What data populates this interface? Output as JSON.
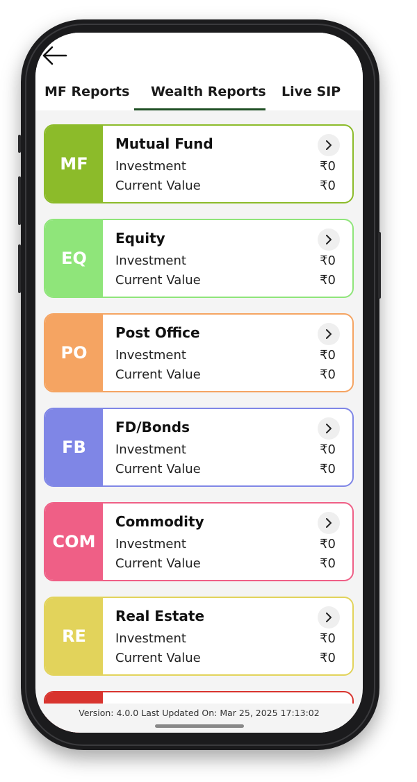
{
  "header": {
    "back_icon": "arrow-left-icon"
  },
  "tabs": [
    {
      "label": "MF Reports",
      "active": false
    },
    {
      "label": "Wealth Reports",
      "active": true
    },
    {
      "label": "Live SIP",
      "active": false
    }
  ],
  "colors": {
    "tab_underline": "#1f4f24",
    "mf": "#8cbb2a",
    "eq": "#8fe57a",
    "po": "#f5a462",
    "fb": "#7f86e6",
    "com": "#ef5f86",
    "re": "#e2d35b",
    "partial": "#d8342e"
  },
  "cards": [
    {
      "badge": "MF",
      "title": "Mutual Fund",
      "investment_label": "Investment",
      "investment_value": "₹0",
      "current_label": "Current Value",
      "current_value": "₹0"
    },
    {
      "badge": "EQ",
      "title": "Equity",
      "investment_label": "Investment",
      "investment_value": "₹0",
      "current_label": "Current Value",
      "current_value": "₹0"
    },
    {
      "badge": "PO",
      "title": "Post Office",
      "investment_label": "Investment",
      "investment_value": "₹0",
      "current_label": "Current Value",
      "current_value": "₹0"
    },
    {
      "badge": "FB",
      "title": "FD/Bonds",
      "investment_label": "Investment",
      "investment_value": "₹0",
      "current_label": "Current Value",
      "current_value": "₹0"
    },
    {
      "badge": "COM",
      "title": "Commodity",
      "investment_label": "Investment",
      "investment_value": "₹0",
      "current_label": "Current Value",
      "current_value": "₹0"
    },
    {
      "badge": "RE",
      "title": "Real Estate",
      "investment_label": "Investment",
      "investment_value": "₹0",
      "current_label": "Current Value",
      "current_value": "₹0"
    }
  ],
  "footer": {
    "text": "Version: 4.0.0 Last Updated On: Mar 25, 2025 17:13:02"
  }
}
